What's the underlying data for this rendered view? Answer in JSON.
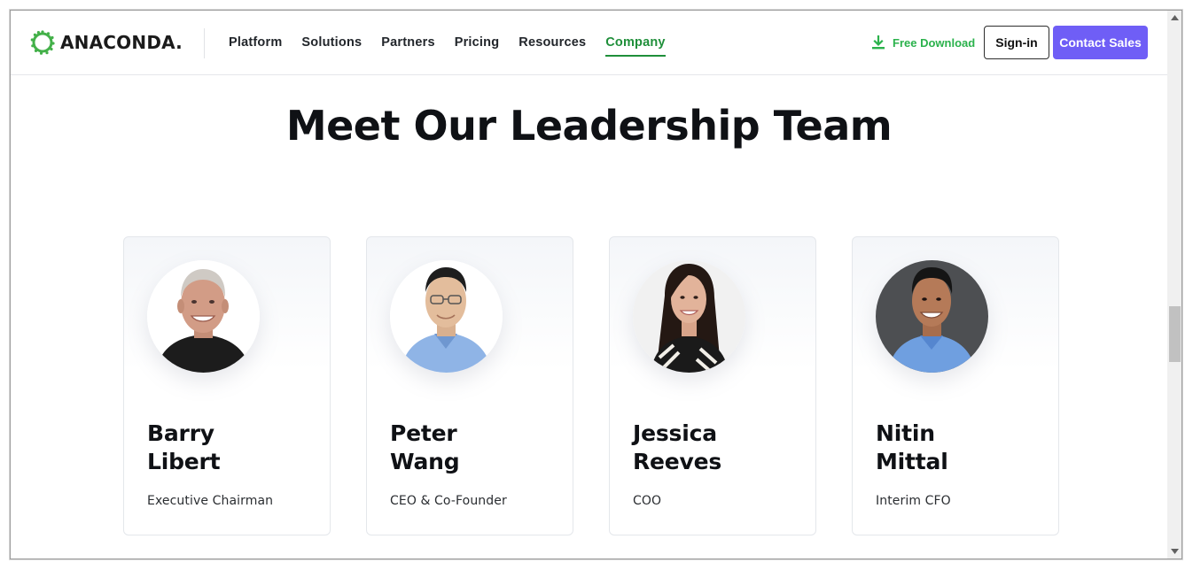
{
  "header": {
    "logo_text": "ANACONDA.",
    "nav": [
      "Platform",
      "Solutions",
      "Partners",
      "Pricing",
      "Resources",
      "Company"
    ],
    "active_nav": "Company",
    "free_download": "Free Download",
    "sign_in": "Sign-in",
    "contact_sales": "Contact Sales"
  },
  "colors": {
    "brand_green": "#2bb24c",
    "active_green": "#1f8f3a",
    "accent_purple": "#6f5ef6"
  },
  "page": {
    "title": "Meet Our Leadership Team"
  },
  "team": [
    {
      "first": "Barry",
      "last": "Libert",
      "role": "Executive Chairman",
      "photo": "barry-libert-photo"
    },
    {
      "first": "Peter",
      "last": "Wang",
      "role": "CEO & Co-Founder",
      "photo": "peter-wang-photo"
    },
    {
      "first": "Jessica",
      "last": "Reeves",
      "role": "COO",
      "photo": "jessica-reeves-photo"
    },
    {
      "first": "Nitin",
      "last": "Mittal",
      "role": "Interim CFO",
      "photo": "nitin-mittal-photo"
    }
  ],
  "icons": {
    "logo": "anaconda-ring-logo",
    "download": "download-icon",
    "scroll_up": "chevron-up-icon",
    "scroll_down": "chevron-down-icon"
  }
}
